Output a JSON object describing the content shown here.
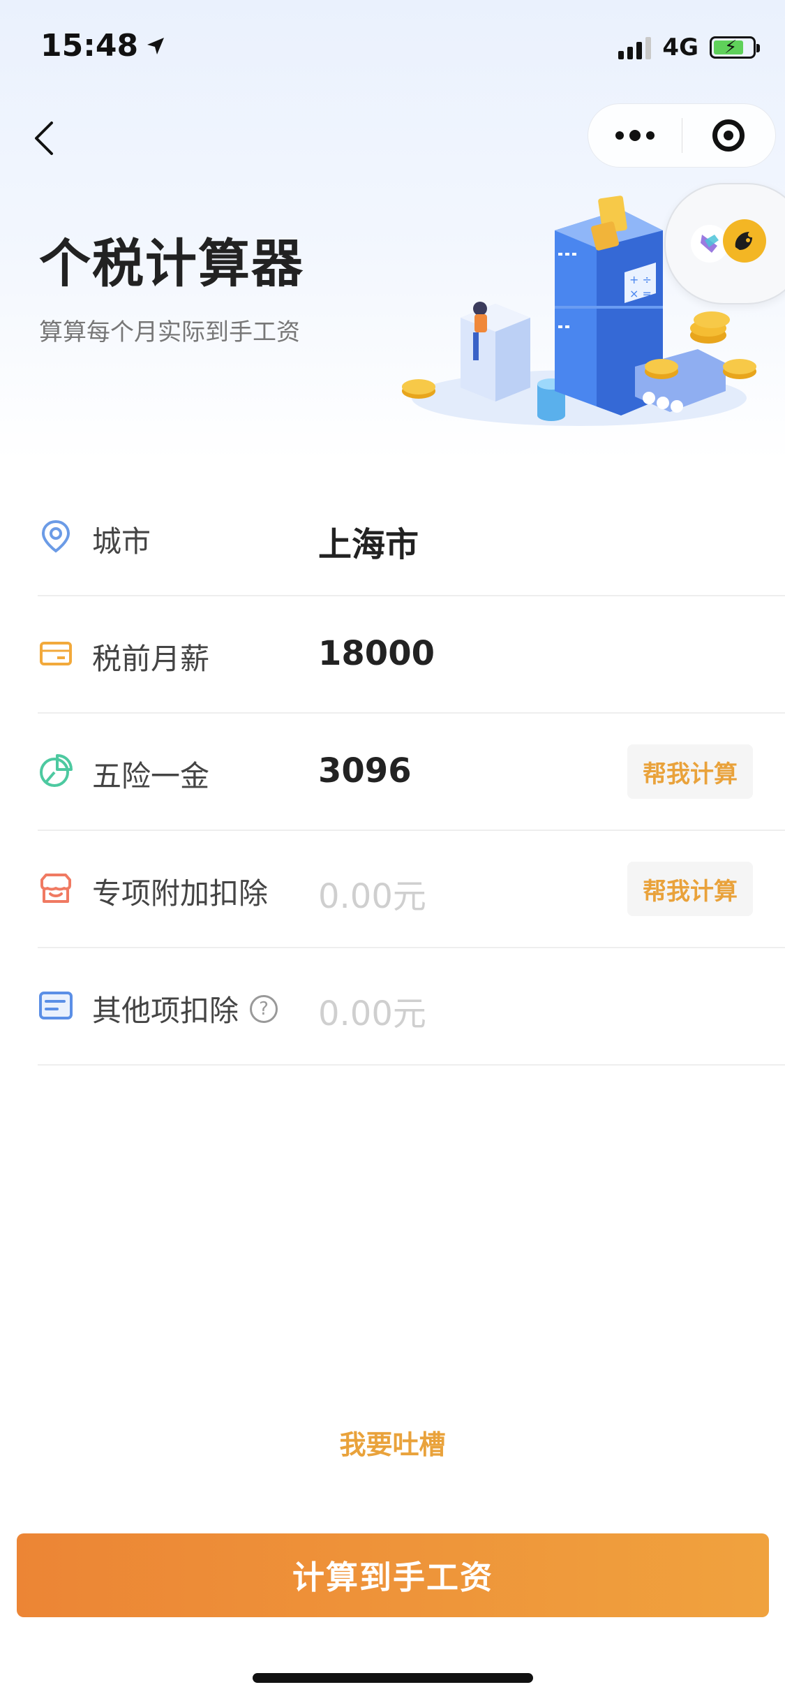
{
  "status_bar": {
    "time": "15:48",
    "network": "4G"
  },
  "header": {
    "title": "个税计算器",
    "subtitle": "算算每个月实际到手工资"
  },
  "form": {
    "rows": [
      {
        "label": "城市",
        "value": "上海市",
        "icon": "location-icon"
      },
      {
        "label": "税前月薪",
        "value": "18000",
        "icon": "card-icon"
      },
      {
        "label": "五险一金",
        "value": "3096",
        "icon": "pie-icon",
        "action": "帮我计算"
      },
      {
        "label": "专项附加扣除",
        "placeholder": "0.00元",
        "icon": "store-icon",
        "action": "帮我计算"
      },
      {
        "label": "其他项扣除",
        "placeholder": "0.00元",
        "icon": "list-icon",
        "help_symbol": "?"
      }
    ]
  },
  "feedback_link": "我要吐槽",
  "submit_button": "计算到手工资",
  "colors": {
    "accent": "#e9a23b",
    "button_start": "#ec8535",
    "button_end": "#f0a23e"
  }
}
